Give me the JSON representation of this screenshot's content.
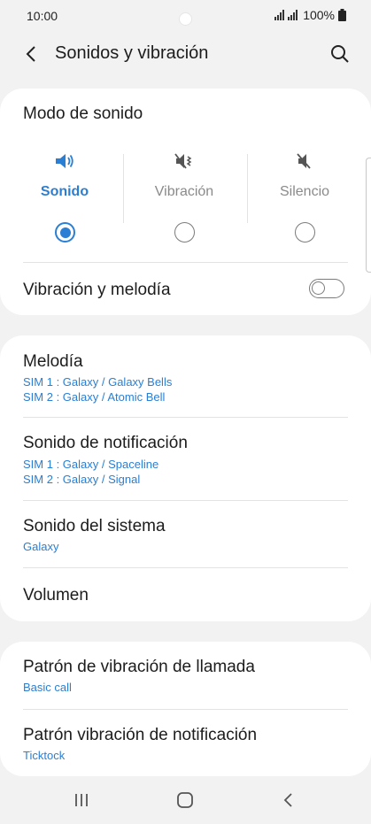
{
  "status": {
    "time": "10:00",
    "battery": "100%"
  },
  "appbar": {
    "title": "Sonidos y vibración"
  },
  "sound_mode": {
    "title": "Modo de sonido",
    "options": [
      {
        "label": "Sonido",
        "icon": "speaker-volume-icon",
        "selected": true
      },
      {
        "label": "Vibración",
        "icon": "vibrate-icon",
        "selected": false
      },
      {
        "label": "Silencio",
        "icon": "mute-icon",
        "selected": false
      }
    ],
    "vibration_and_ringtone": {
      "label": "Vibración y melodía",
      "enabled": false
    }
  },
  "sounds": {
    "ringtone": {
      "title": "Melodía",
      "sim1": "SIM 1 : Galaxy / Galaxy Bells",
      "sim2": "SIM 2 : Galaxy / Atomic Bell"
    },
    "notification": {
      "title": "Sonido de notificación",
      "sim1": "SIM 1 : Galaxy / Spaceline",
      "sim2": "SIM 2 : Galaxy / Signal"
    },
    "system": {
      "title": "Sonido del sistema",
      "value": "Galaxy"
    },
    "volume": {
      "title": "Volumen"
    }
  },
  "vibration": {
    "call_pattern": {
      "title": "Patrón de vibración de llamada",
      "value": "Basic call"
    },
    "notification_pattern": {
      "title": "Patrón vibración de notificación",
      "value": "Ticktock"
    }
  },
  "colors": {
    "accent": "#2a7fd4",
    "background": "#f2f2f2",
    "card": "#ffffff"
  }
}
